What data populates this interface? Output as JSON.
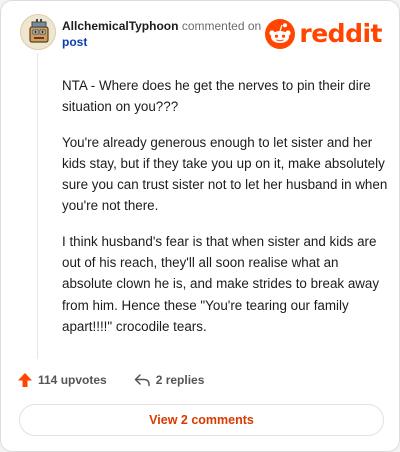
{
  "comment": {
    "author": "AllchemicalTyphoon",
    "action_text": "commented on",
    "target_link": "post",
    "paragraphs": [
      "NTA - Where does he get the nerves to pin their dire situation on you???",
      "You're already generous enough to let sister and her kids stay, but if they take you up on it, make absolutely sure you can trust sister not to let her husband in when you're not there.",
      "I think husband's fear is that when sister and kids are out of his reach, they'll all soon realise what an absolute clown he is, and make strides to break away from him. Hence these \"You're tearing our family apart!!!!\" crocodile tears."
    ]
  },
  "brand": {
    "wordmark": "reddit",
    "color": "#ff4500"
  },
  "actions": {
    "upvotes_label": "114 upvotes",
    "replies_label": "2 replies",
    "upvote_icon": "upvote-arrow-icon",
    "reply_icon": "reply-arrow-icon"
  },
  "footer": {
    "view_comments_label": "View 2 comments"
  }
}
